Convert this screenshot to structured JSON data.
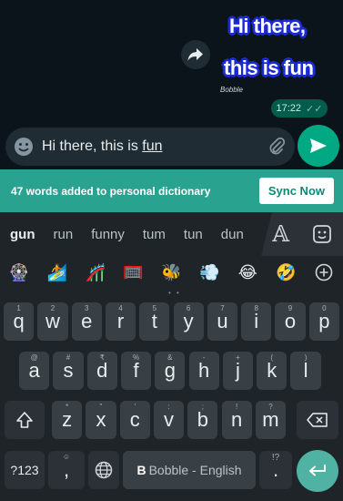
{
  "chat": {
    "sticker_line1": "Hi there,",
    "sticker_line2": "this is fun",
    "sticker_brand": "Bobble",
    "time": "17:22",
    "ticks": "✓✓"
  },
  "compose": {
    "text_prefix": "Hi there, this is ",
    "text_underlined": "fun"
  },
  "dictionary": {
    "message": "47 words added to personal dictionary",
    "sync_label": "Sync Now"
  },
  "suggestions": [
    "gun",
    "run",
    "funny",
    "tum",
    "tun",
    "dun"
  ],
  "emojis": [
    "🎡",
    "🏄",
    "🎢",
    "🥅",
    "🐝",
    "💨",
    "😂",
    "🤣"
  ],
  "rows": {
    "row1": [
      [
        "q",
        "1"
      ],
      [
        "w",
        "2"
      ],
      [
        "e",
        "3"
      ],
      [
        "r",
        "4"
      ],
      [
        "t",
        "5"
      ],
      [
        "y",
        "6"
      ],
      [
        "u",
        "7"
      ],
      [
        "i",
        "8"
      ],
      [
        "o",
        "9"
      ],
      [
        "p",
        "0"
      ]
    ],
    "row2": [
      [
        "a",
        "@"
      ],
      [
        "s",
        "#"
      ],
      [
        "d",
        "₹"
      ],
      [
        "f",
        "%"
      ],
      [
        "g",
        "&"
      ],
      [
        "h",
        "-"
      ],
      [
        "j",
        "+"
      ],
      [
        "k",
        "("
      ],
      [
        "l",
        ")"
      ]
    ],
    "row3": [
      [
        "z",
        "*"
      ],
      [
        "x",
        "\""
      ],
      [
        "c",
        "'"
      ],
      [
        "v",
        ":"
      ],
      [
        "b",
        ";"
      ],
      [
        "n",
        "!"
      ],
      [
        "m",
        "?"
      ]
    ]
  },
  "bottom": {
    "symbols_label": "?123",
    "comma": ",",
    "space_label": "Bobble - English",
    "period": ".",
    "punct_hint": "!?"
  },
  "colors": {
    "accent": "#00a884",
    "dict_bar": "#29a390",
    "key_bg": "#394045"
  }
}
